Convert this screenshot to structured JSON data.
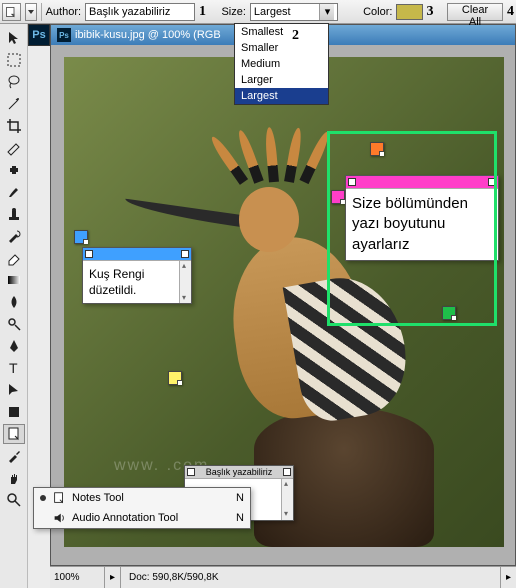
{
  "toolbar": {
    "author_label": "Author:",
    "author_value": "Başlık yazabiliriz",
    "badge1": "1",
    "size_label": "Size:",
    "size_value": "Largest",
    "badge2": "2",
    "size_options": [
      "Smallest",
      "Smaller",
      "Medium",
      "Larger",
      "Largest"
    ],
    "color_label": "Color:",
    "color_hex": "#c6b84a",
    "badge3": "3",
    "clear_label": "Clear All",
    "badge4": "4"
  },
  "ps_logo": "Ps",
  "document": {
    "title": "ibibik-kusu.jpg @ 100% (RGB",
    "watermark": "www.                    .com"
  },
  "notes": {
    "blue": {
      "text": "Kuş Rengi düzetildi."
    },
    "pink": {
      "text": "Size bölümünden yazı boyutunu ayarlarız"
    },
    "gray": {
      "title": "Başlık yazabiliriz"
    }
  },
  "flyout": {
    "items": [
      {
        "label": "Notes Tool",
        "key": "N",
        "active": true
      },
      {
        "label": "Audio Annotation Tool",
        "key": "N",
        "active": false
      }
    ]
  },
  "status": {
    "zoom": "100%",
    "doc_info": "Doc: 590,8K/590,8K"
  }
}
